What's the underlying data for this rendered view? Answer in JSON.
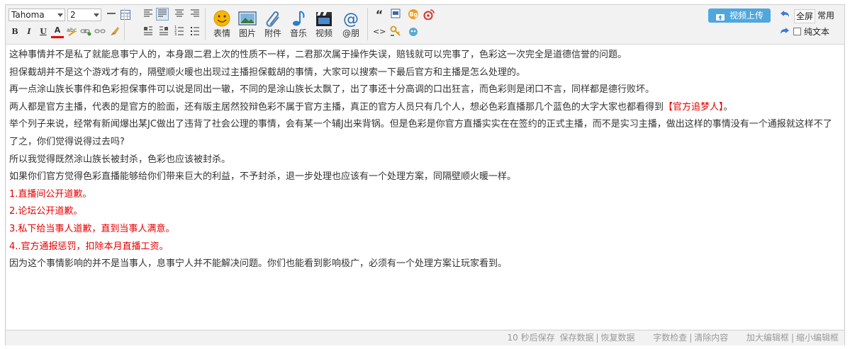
{
  "toolbar": {
    "font": "Tahoma",
    "size": "2",
    "big_buttons": [
      {
        "label": "表情"
      },
      {
        "label": "图片"
      },
      {
        "label": "附件"
      },
      {
        "label": "音乐"
      },
      {
        "label": "视频"
      },
      {
        "label": "@朋"
      }
    ],
    "video_upload": "视频上传",
    "fullscreen": "全屏",
    "common": "常用",
    "plaintext": "纯文本",
    "format": {
      "bold": "B",
      "italic": "I",
      "underline": "U",
      "fontcolor": "A",
      "quote": "“",
      "code": "<>"
    }
  },
  "content": {
    "paragraphs": [
      {
        "text": "这种事情并不是私了就能息事宁人的，本身跟二君上次的性质不一样，二君那次属于操作失误，赔钱就可以完事了，色彩这一次完全是道德信誉的问题。"
      },
      {
        "text": "担保截胡并不是这个游戏才有的，隔壁顺火暖也出现过主播担保截胡的事情，大家可以搜索一下最后官方和主播是怎么处理的。"
      },
      {
        "text": "再一点涂山族长事件和色彩担保事件可以说是同出一辙，不同的是涂山族长太飘了，出了事还十分高调的口出狂言，而色彩则是闭口不言，同样都是德行败坏。"
      },
      {
        "text": "两人都是官方主播，代表的是官方的脸面，还有版主居然狡辩色彩不属于官方主播，真正的官方人员只有几个人，想必色彩直播那几个蓝色的大字大家也都看得到",
        "red": "【官方追梦人】",
        "after": "。"
      },
      {
        "text": "举个列子来说，经常有新闻爆出某JC做出了违背了社会公理的事情，会有某一个辅J出来背锅。但是色彩是你官方直播实实在在签约的正式主播，而不是实习主播，做出这样的事情没有一个通报就这样不了了之，你们觉得说得过去吗?"
      },
      {
        "text": "所以我觉得既然涂山族长被封杀，色彩也应该被封杀。"
      },
      {
        "text": "如果你们官方觉得色彩直播能够给你们带来巨大的利益，不予封杀，退一步处理也应该有一个处理方案，同隔壁顺火暖一样。"
      },
      {
        "text": "1.直播间公开道歉。",
        "color": "red"
      },
      {
        "text": "2.论坛公开道歉。",
        "color": "red"
      },
      {
        "text": "3.私下给当事人道歉，直到当事人满意。",
        "color": "red"
      },
      {
        "text": "4..官方通报惩罚，扣除本月直播工资。",
        "color": "red"
      },
      {
        "text": "因为这个事情影响的并不是当事人，息事宁人并不能解决问题。你们也能看到影响极广，必须有一个处理方案让玩家看到。"
      }
    ]
  },
  "status": {
    "autosave": "10 秒后保存",
    "save": "保存数据",
    "restore": "恢复数据",
    "wordcheck": "字数检查",
    "clear": "清除内容",
    "enlarge": "加大编辑框",
    "shrink": "缩小编辑框"
  },
  "colors": {
    "accent": "#4fa7dc",
    "red": "#e60000",
    "text": "#333333"
  }
}
